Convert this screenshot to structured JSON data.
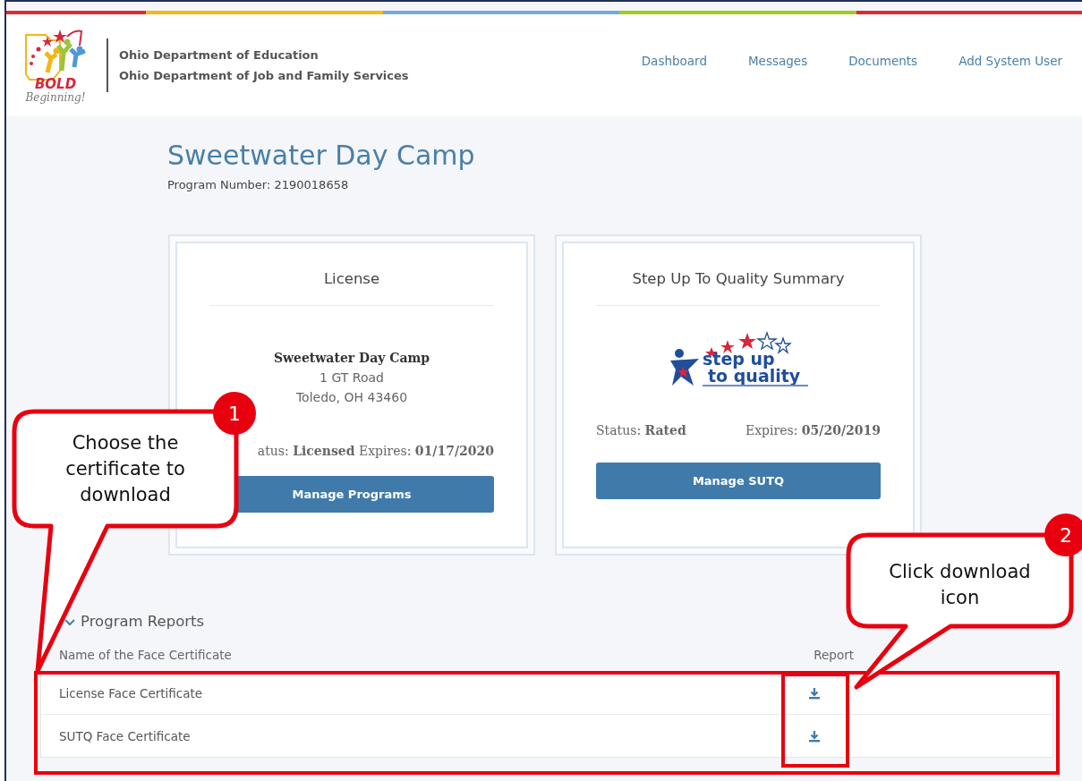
{
  "header": {
    "logo": {
      "line1": "BOLD",
      "line2": "Beginning!"
    },
    "departments": [
      "Ohio Department of Education",
      "Ohio Department of Job and Family Services"
    ],
    "nav": [
      "Dashboard",
      "Messages",
      "Documents",
      "Add System User"
    ]
  },
  "program": {
    "title": "Sweetwater Day Camp",
    "number": "Program Number: 2190018658"
  },
  "cards": [
    {
      "kind": "license",
      "title": "License",
      "name": "Sweetwater Day Camp",
      "address": [
        "1 GT Road",
        "Toledo, OH 43460"
      ],
      "status": "atus: **Licensed** Expires: **01/17/2020**",
      "button": "Manage Programs"
    },
    {
      "kind": "sutq",
      "title": "Step Up To Quality Summary",
      "logo": {
        "line1": "step up",
        "line2": "to quality"
      },
      "status": "Status: **Rated**",
      "expires": "Expires: **05/20/2019**",
      "button": "Manage SUTQ"
    }
  ],
  "reports": {
    "title": "Program Reports",
    "expanded": true,
    "columns": [
      "Name of the Face Certificate",
      "Report"
    ],
    "rows": [
      {
        "name": "License Face Certificate"
      },
      {
        "name": "SUTQ Face Certificate"
      }
    ]
  },
  "callouts": [
    {
      "number": "1",
      "text": "Choose the certificate to download"
    },
    {
      "number": "2",
      "text": "Click download icon"
    }
  ]
}
